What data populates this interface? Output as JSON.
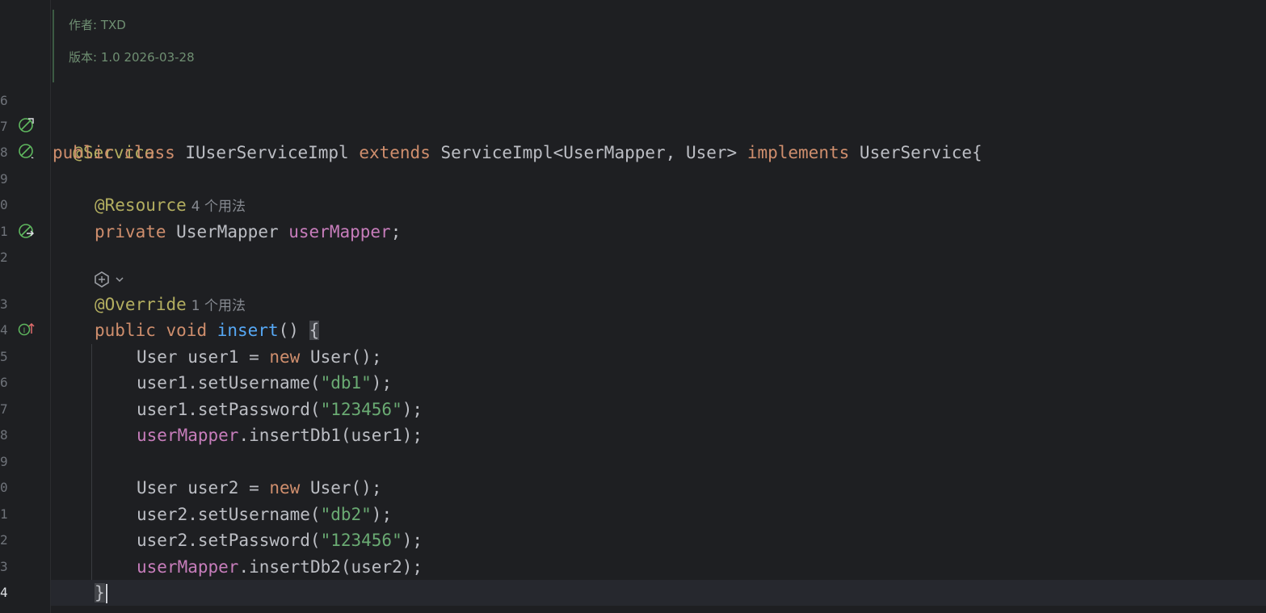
{
  "doc_comment": {
    "author": "作者: TXD",
    "version": "版本: 1.0 2026-03-28"
  },
  "line_numbers": [
    "6",
    "7",
    "8",
    "9",
    "0",
    "1",
    "2",
    "3",
    "4",
    "5",
    "6",
    "7",
    "8",
    "9",
    "0",
    "1",
    "2",
    "3",
    "4"
  ],
  "code": {
    "service_ann": "@Service",
    "class_kw1": "public",
    "class_kw2": "class",
    "class_name": "IUserServiceImpl",
    "extends_kw": "extends",
    "extends_type": "ServiceImpl<UserMapper, User>",
    "implements_kw": "implements",
    "iface": "UserService{",
    "resource_ann": "@Resource",
    "resource_usages": "4 个用法",
    "field_kw": "private",
    "field_type": "UserMapper",
    "field_name": "userMapper",
    "field_semi": ";",
    "override_ann": "@Override",
    "override_usages": "1 个用法",
    "m_kw1": "public",
    "m_kw2": "void",
    "m_name": "insert",
    "m_parens": "()",
    "m_open": "{",
    "l1_a": "User user1 = ",
    "l1_new": "new",
    "l1_b": " User();",
    "l2_a": "user1.setUsername(",
    "l2_s": "\"db1\"",
    "l2_b": ");",
    "l3_a": "user1.setPassword(",
    "l3_s": "\"123456\"",
    "l3_b": ");",
    "l4_f": "userMapper",
    "l4_b": ".insertDb1(user1);",
    "l5_a": "User user2 = ",
    "l5_new": "new",
    "l5_b": " User();",
    "l6_a": "user2.setUsername(",
    "l6_s": "\"db2\"",
    "l6_b": ");",
    "l7_a": "user2.setPassword(",
    "l7_s": "\"123456\"",
    "l7_b": ");",
    "l8_f": "userMapper",
    "l8_b": ".insertDb2(user2);",
    "close": "}"
  },
  "colors": {
    "background": "#1e1f22",
    "keyword": "#cf8e6d",
    "annotation": "#b3ae60",
    "field": "#c77dbb",
    "string": "#6aab73",
    "method": "#56a8f5"
  }
}
